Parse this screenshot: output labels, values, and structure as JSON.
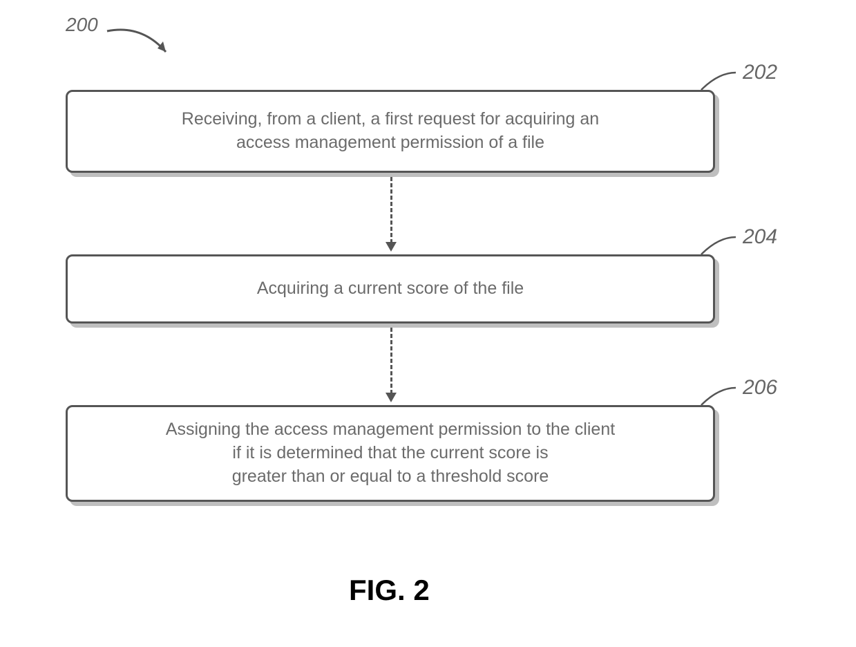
{
  "figure": {
    "number_label": "200",
    "caption": "FIG. 2"
  },
  "steps": [
    {
      "ref": "202",
      "text": "Receiving, from a client, a first request for acquiring an\naccess management permission of a file"
    },
    {
      "ref": "204",
      "text": "Acquiring a current score of the file"
    },
    {
      "ref": "206",
      "text": "Assigning the access management permission to the client\nif it is determined that the current score is\ngreater than or equal to a threshold score"
    }
  ]
}
